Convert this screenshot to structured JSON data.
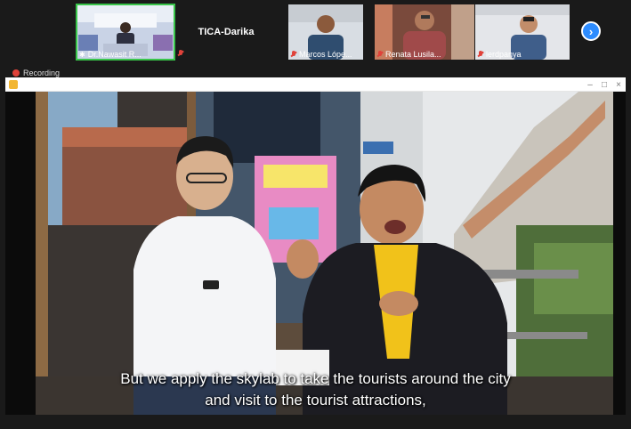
{
  "participants": [
    {
      "name": "Dr.Nawasit R...",
      "muted": false,
      "active": true
    },
    {
      "name": "TICA-Darika",
      "muted": true,
      "video": false
    },
    {
      "name": "Marcos Lópe...",
      "muted": true
    },
    {
      "name": "Renata Lusila...",
      "muted": true
    },
    {
      "name": "lerdpanya",
      "muted": true
    }
  ],
  "recording": {
    "label": "Recording"
  },
  "video": {
    "subtitle_line1": "But we apply the skylab to take the tourists around the city",
    "subtitle_line2": "and visit to the tourist attractions,"
  },
  "icons": {
    "next": "chevron-right-icon",
    "mic_muted": "mic-muted-icon",
    "recording": "record-dot-icon"
  },
  "colors": {
    "accent": "#2d8cff",
    "active_speaker": "#39c54a",
    "recording": "#e0423a"
  }
}
